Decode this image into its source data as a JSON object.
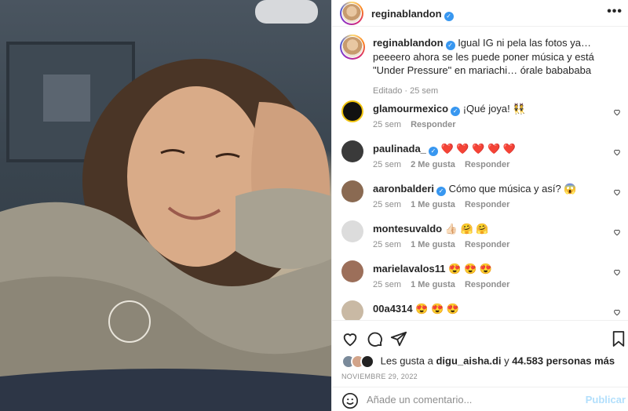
{
  "header": {
    "username": "reginablandon",
    "verified": true
  },
  "caption": {
    "username": "reginablandon",
    "text": "Igual IG ni pela las fotos ya… peeeero ahora se les puede poner música y está \"Under Pressure\" en mariachi… órale babababa",
    "edited": "Editado",
    "time": "25 sem"
  },
  "comments": [
    {
      "username": "glamourmexico",
      "verified": true,
      "text": "¡Qué joya! 👯",
      "time": "25 sem",
      "likes": "",
      "reply": "Responder",
      "avatar_color": "#111111"
    },
    {
      "username": "paulinada_",
      "verified": true,
      "text": "❤️ ❤️ ❤️ ❤️ ❤️",
      "time": "25 sem",
      "likes": "2 Me gusta",
      "reply": "Responder",
      "avatar_color": "#3a3a3a"
    },
    {
      "username": "aaronbalderi",
      "verified": true,
      "text": "Cómo que música y así? 😱",
      "time": "25 sem",
      "likes": "1 Me gusta",
      "reply": "Responder",
      "avatar_color": "#8a6a52"
    },
    {
      "username": "montesuvaldo",
      "verified": false,
      "text": "👍🏻 🤗 🤗",
      "time": "25 sem",
      "likes": "1 Me gusta",
      "reply": "Responder",
      "avatar_color": "#dcdcdc"
    },
    {
      "username": "marielavalos11",
      "verified": false,
      "text": "😍 😍 😍",
      "time": "25 sem",
      "likes": "1 Me gusta",
      "reply": "Responder",
      "avatar_color": "#9c6f5a"
    },
    {
      "username": "00a4314",
      "verified": false,
      "text": "😍 😍 😍",
      "time": "",
      "likes": "",
      "reply": "",
      "avatar_color": "#c9b9a4"
    }
  ],
  "likes_line": {
    "prefix": "Les gusta a",
    "user": "digu_aisha.di",
    "joiner": "y",
    "count": "44.583 personas más"
  },
  "date": "NOVIEMBRE 29, 2022",
  "add_comment": {
    "placeholder": "Añade un comentario...",
    "publish": "Publicar"
  },
  "icons": {
    "like": "heart-icon",
    "comment": "comment-icon",
    "share": "share-icon",
    "save": "bookmark-icon",
    "emoji": "emoji-icon",
    "more": "more-icon"
  },
  "colors": {
    "verified": "#3897f0",
    "publish_disabled": "#b2dffc",
    "muted": "#8e8e8e"
  }
}
